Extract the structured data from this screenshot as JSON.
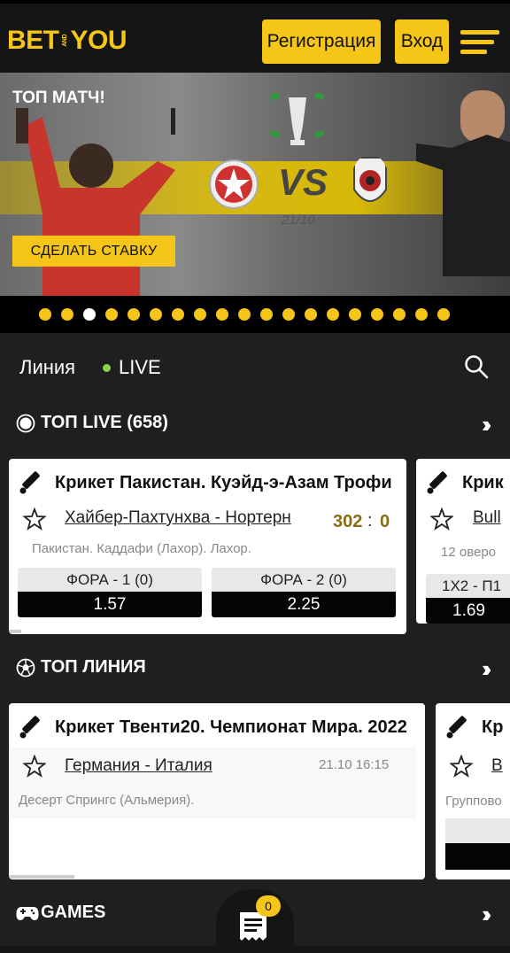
{
  "header": {
    "logo_left": "BET",
    "logo_and": "AND",
    "logo_right": "YOU",
    "register_label": "Регистрация",
    "login_label": "Вход"
  },
  "banner": {
    "title": "ТОП МАТЧ!",
    "vs": "VS",
    "date": "21/10",
    "cta_label": "СДЕЛАТЬ СТАВКУ",
    "slides_total": 19,
    "active_slide": 3
  },
  "tabs": {
    "line_label": "Линия",
    "live_label": "LIVE"
  },
  "top_live": {
    "title": "ТОП LIVE (658)",
    "cards": [
      {
        "league": "Крикет Пакистан. Куэйд-э-Азам Трофи",
        "teams": "Хайбер-Пахтунхва - Нортерн",
        "score_home": "302",
        "score_sep": ":",
        "score_away": "0",
        "venue": "Пакистан. Каддафи (Лахор). Лахор.",
        "odds": [
          {
            "label": "ФОРА - 1 (0)",
            "value": "1.57"
          },
          {
            "label": "ФОРА - 2 (0)",
            "value": "2.25"
          }
        ]
      },
      {
        "league": "Крик",
        "teams": "Bull",
        "venue": "12 оверо",
        "odds": [
          {
            "label": "1X2 - П1",
            "value": "1.69"
          }
        ]
      }
    ]
  },
  "top_line": {
    "title": "ТОП ЛИНИЯ",
    "cards": [
      {
        "league": "Крикет Твенти20. Чемпионат Мира. 2022",
        "teams": "Германия - Италия",
        "datetime": "21.10 16:15",
        "venue": "Десерт Спрингс (Альмерия)."
      },
      {
        "league": "Кр",
        "teams": "В",
        "venue": "Группово"
      }
    ]
  },
  "games": {
    "title": "GAMES"
  },
  "coupon": {
    "count": "0"
  },
  "colors": {
    "brand_yellow": "#f5c518",
    "background": "#1f1f1f",
    "live_green": "#8bd34a",
    "score_gold": "#8a6d12"
  }
}
